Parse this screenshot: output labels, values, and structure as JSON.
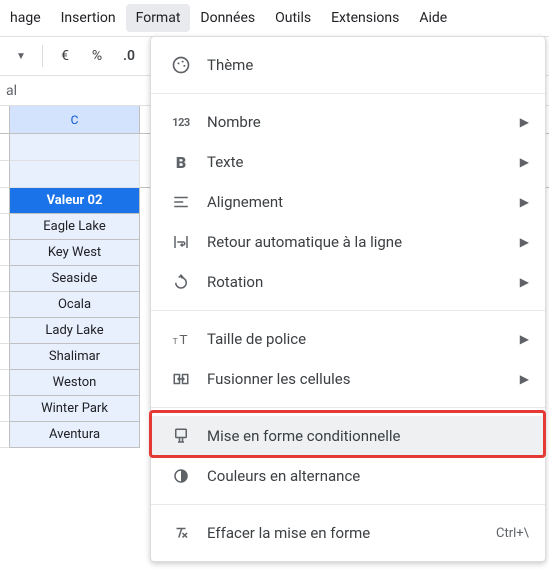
{
  "menubar": {
    "items": [
      {
        "label": "hage"
      },
      {
        "label": "Insertion"
      },
      {
        "label": "Format",
        "active": true
      },
      {
        "label": "Données"
      },
      {
        "label": "Outils"
      },
      {
        "label": "Extensions"
      },
      {
        "label": "Aide"
      }
    ]
  },
  "toolbar": {
    "currency": "€",
    "percent": "%",
    "dec_less": ".0",
    "dec_sub": "←"
  },
  "formula_bar": {
    "text": "al"
  },
  "sheet": {
    "col_label": "C",
    "header_value": "Valeur 02",
    "rows": [
      "Eagle Lake",
      "Key West",
      "Seaside",
      "Ocala",
      "Lady Lake",
      "Shalimar",
      "Weston",
      "Winter Park",
      "Aventura"
    ]
  },
  "menu": {
    "theme": "Thème",
    "number": "Nombre",
    "text": "Texte",
    "align": "Alignement",
    "wrap": "Retour automatique à la ligne",
    "rotate": "Rotation",
    "fontsize": "Taille de police",
    "merge": "Fusionner les cellules",
    "cond": "Mise en forme conditionnelle",
    "altcolors": "Couleurs en alternance",
    "clear": "Effacer la mise en forme",
    "clear_short": "Ctrl+\\"
  }
}
